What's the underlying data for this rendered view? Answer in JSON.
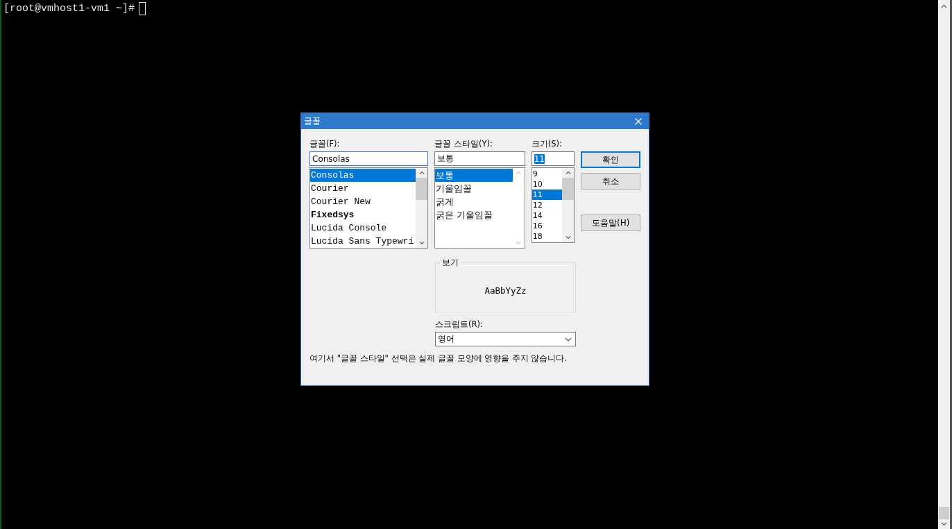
{
  "terminal": {
    "prompt": "[root@vmhost1-vm1 ~]#"
  },
  "dialog": {
    "title": "글꼴",
    "font": {
      "label": "글꼴(F):",
      "value": "Consolas",
      "value_selected": false,
      "scrollbar_enabled": true,
      "items": [
        {
          "text": "Consolas",
          "selected": true,
          "bold": false
        },
        {
          "text": "Courier",
          "selected": false,
          "bold": false
        },
        {
          "text": "Courier New",
          "selected": false,
          "bold": false
        },
        {
          "text": "Fixedsys",
          "selected": false,
          "bold": true
        },
        {
          "text": "Lucida Console",
          "selected": false,
          "bold": false
        },
        {
          "text": "Lucida Sans Typewri",
          "selected": false,
          "bold": false
        }
      ]
    },
    "style": {
      "label": "글꼴 스타일(Y):",
      "value": "보통",
      "value_selected": false,
      "scrollbar_enabled": false,
      "items": [
        {
          "text": "보통",
          "selected": true,
          "bold": false
        },
        {
          "text": "기울임꼴",
          "selected": false,
          "bold": false
        },
        {
          "text": "굵게",
          "selected": false,
          "bold": false
        },
        {
          "text": "굵은 기울임꼴",
          "selected": false,
          "bold": false
        }
      ]
    },
    "size": {
      "label": "크기(S):",
      "value": "11",
      "value_selected": true,
      "scrollbar_enabled": true,
      "items": [
        {
          "text": "9",
          "selected": false,
          "bold": false
        },
        {
          "text": "10",
          "selected": false,
          "bold": false
        },
        {
          "text": "11",
          "selected": true,
          "bold": false
        },
        {
          "text": "12",
          "selected": false,
          "bold": false
        },
        {
          "text": "14",
          "selected": false,
          "bold": false
        },
        {
          "text": "16",
          "selected": false,
          "bold": false
        },
        {
          "text": "18",
          "selected": false,
          "bold": false
        }
      ]
    },
    "buttons": [
      {
        "label": "확인",
        "default": true
      },
      {
        "label": "취소",
        "default": false
      },
      {
        "label": "도움말(H)",
        "default": false
      }
    ],
    "preview": {
      "label": "보기",
      "sample": "AaBbYyZz"
    },
    "script": {
      "label": "스크립트(R):",
      "value": "영어"
    },
    "note": "여기서 \"글꼴 스타일\" 선택은 실제 글꼴 모양에 영향을 주지 않습니다."
  }
}
